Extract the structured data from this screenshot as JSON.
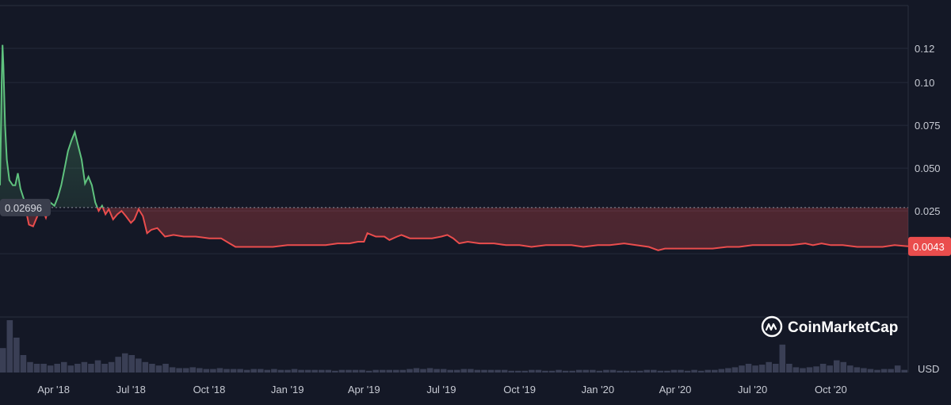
{
  "brand": {
    "name": "CoinMarketCap",
    "icon": "coinmarketcap-logo-icon"
  },
  "currency_label": "USD",
  "colors": {
    "background": "#141826",
    "up": "#5fc27e",
    "down": "#ea4d4d",
    "grid": "#2a2f3f",
    "baseline": "#8a8f9c",
    "volume": "#3a3f55"
  },
  "chart_data": {
    "type": "line",
    "title": "",
    "xlabel": "",
    "ylabel": "",
    "ylim": [
      -0.037,
      0.145
    ],
    "yticks": [
      0.025,
      0.05,
      0.075,
      0.1,
      0.12
    ],
    "ytick_labels": [
      "0.025",
      "0.050",
      "0.075",
      "0.10",
      "0.12"
    ],
    "xticks": [
      "2018-04-01",
      "2018-07-01",
      "2018-10-01",
      "2019-01-01",
      "2019-04-01",
      "2019-07-01",
      "2019-10-01",
      "2020-01-01",
      "2020-04-01",
      "2020-07-01",
      "2020-10-01"
    ],
    "xtick_labels": [
      "Apr '18",
      "Jul '18",
      "Oct '18",
      "Jan '19",
      "Apr '19",
      "Jul '19",
      "Oct '19",
      "Jan '20",
      "Apr '20",
      "Jul '20",
      "Oct '20"
    ],
    "xlim": [
      "2018-01-28",
      "2020-12-31"
    ],
    "baseline": {
      "value": 0.02696,
      "label": "0.02696"
    },
    "last_price": {
      "value": 0.0043,
      "label": "0.0043"
    },
    "grid": true,
    "series": [
      {
        "points": [
          [
            "2018-01-28",
            0.04
          ],
          [
            "2018-01-29",
            0.07
          ],
          [
            "2018-01-30",
            0.1
          ],
          [
            "2018-01-31",
            0.122
          ],
          [
            "2018-02-01",
            0.11
          ],
          [
            "2018-02-03",
            0.075
          ],
          [
            "2018-02-05",
            0.055
          ],
          [
            "2018-02-08",
            0.043
          ],
          [
            "2018-02-12",
            0.04
          ],
          [
            "2018-02-15",
            0.04
          ],
          [
            "2018-02-18",
            0.047
          ],
          [
            "2018-02-21",
            0.038
          ],
          [
            "2018-02-25",
            0.032
          ],
          [
            "2018-02-28",
            0.024
          ],
          [
            "2018-03-03",
            0.017
          ],
          [
            "2018-03-08",
            0.016
          ],
          [
            "2018-03-13",
            0.022
          ],
          [
            "2018-03-18",
            0.027
          ],
          [
            "2018-03-23",
            0.021
          ],
          [
            "2018-03-28",
            0.03
          ],
          [
            "2018-04-02",
            0.028
          ],
          [
            "2018-04-06",
            0.033
          ],
          [
            "2018-04-10",
            0.04
          ],
          [
            "2018-04-14",
            0.05
          ],
          [
            "2018-04-18",
            0.06
          ],
          [
            "2018-04-22",
            0.066
          ],
          [
            "2018-04-26",
            0.071
          ],
          [
            "2018-04-30",
            0.063
          ],
          [
            "2018-05-04",
            0.055
          ],
          [
            "2018-05-08",
            0.041
          ],
          [
            "2018-05-12",
            0.045
          ],
          [
            "2018-05-16",
            0.04
          ],
          [
            "2018-05-20",
            0.03
          ],
          [
            "2018-05-24",
            0.025
          ],
          [
            "2018-05-28",
            0.028
          ],
          [
            "2018-06-01",
            0.023
          ],
          [
            "2018-06-05",
            0.026
          ],
          [
            "2018-06-10",
            0.02
          ],
          [
            "2018-06-15",
            0.023
          ],
          [
            "2018-06-20",
            0.025
          ],
          [
            "2018-06-25",
            0.022
          ],
          [
            "2018-07-01",
            0.018
          ],
          [
            "2018-07-05",
            0.02
          ],
          [
            "2018-07-10",
            0.026
          ],
          [
            "2018-07-15",
            0.022
          ],
          [
            "2018-07-20",
            0.012
          ],
          [
            "2018-07-25",
            0.014
          ],
          [
            "2018-08-01",
            0.015
          ],
          [
            "2018-08-10",
            0.01
          ],
          [
            "2018-08-20",
            0.011
          ],
          [
            "2018-09-01",
            0.01
          ],
          [
            "2018-09-15",
            0.01
          ],
          [
            "2018-10-01",
            0.009
          ],
          [
            "2018-10-15",
            0.009
          ],
          [
            "2018-10-25",
            0.006
          ],
          [
            "2018-11-01",
            0.004
          ],
          [
            "2018-11-15",
            0.004
          ],
          [
            "2018-12-01",
            0.004
          ],
          [
            "2018-12-15",
            0.004
          ],
          [
            "2019-01-01",
            0.005
          ],
          [
            "2019-01-15",
            0.005
          ],
          [
            "2019-02-01",
            0.005
          ],
          [
            "2019-02-15",
            0.005
          ],
          [
            "2019-03-01",
            0.006
          ],
          [
            "2019-03-15",
            0.006
          ],
          [
            "2019-03-25",
            0.007
          ],
          [
            "2019-04-01",
            0.007
          ],
          [
            "2019-04-05",
            0.012
          ],
          [
            "2019-04-15",
            0.01
          ],
          [
            "2019-04-25",
            0.01
          ],
          [
            "2019-05-01",
            0.008
          ],
          [
            "2019-05-10",
            0.01
          ],
          [
            "2019-05-15",
            0.011
          ],
          [
            "2019-05-25",
            0.009
          ],
          [
            "2019-06-05",
            0.009
          ],
          [
            "2019-06-20",
            0.009
          ],
          [
            "2019-07-01",
            0.01
          ],
          [
            "2019-07-08",
            0.011
          ],
          [
            "2019-07-15",
            0.009
          ],
          [
            "2019-07-22",
            0.006
          ],
          [
            "2019-08-01",
            0.007
          ],
          [
            "2019-08-15",
            0.006
          ],
          [
            "2019-09-01",
            0.006
          ],
          [
            "2019-09-15",
            0.005
          ],
          [
            "2019-10-01",
            0.005
          ],
          [
            "2019-10-15",
            0.004
          ],
          [
            "2019-11-01",
            0.005
          ],
          [
            "2019-11-15",
            0.005
          ],
          [
            "2019-12-01",
            0.005
          ],
          [
            "2019-12-15",
            0.004
          ],
          [
            "2020-01-01",
            0.005
          ],
          [
            "2020-01-15",
            0.005
          ],
          [
            "2020-02-01",
            0.006
          ],
          [
            "2020-02-15",
            0.005
          ],
          [
            "2020-03-01",
            0.004
          ],
          [
            "2020-03-12",
            0.002
          ],
          [
            "2020-03-20",
            0.003
          ],
          [
            "2020-04-01",
            0.003
          ],
          [
            "2020-04-15",
            0.003
          ],
          [
            "2020-05-01",
            0.003
          ],
          [
            "2020-05-15",
            0.003
          ],
          [
            "2020-06-01",
            0.004
          ],
          [
            "2020-06-15",
            0.004
          ],
          [
            "2020-07-01",
            0.005
          ],
          [
            "2020-07-15",
            0.005
          ],
          [
            "2020-08-01",
            0.005
          ],
          [
            "2020-08-15",
            0.005
          ],
          [
            "2020-09-01",
            0.006
          ],
          [
            "2020-09-10",
            0.005
          ],
          [
            "2020-09-20",
            0.006
          ],
          [
            "2020-10-01",
            0.005
          ],
          [
            "2020-10-15",
            0.005
          ],
          [
            "2020-11-01",
            0.004
          ],
          [
            "2020-11-15",
            0.004
          ],
          [
            "2020-12-01",
            0.004
          ],
          [
            "2020-12-15",
            0.005
          ],
          [
            "2020-12-31",
            0.0043
          ]
        ]
      }
    ],
    "volume": [
      0.28,
      0.6,
      0.4,
      0.2,
      0.12,
      0.1,
      0.1,
      0.08,
      0.1,
      0.12,
      0.08,
      0.1,
      0.12,
      0.1,
      0.14,
      0.1,
      0.12,
      0.18,
      0.22,
      0.2,
      0.16,
      0.12,
      0.1,
      0.08,
      0.1,
      0.06,
      0.05,
      0.05,
      0.06,
      0.05,
      0.04,
      0.04,
      0.05,
      0.04,
      0.04,
      0.04,
      0.03,
      0.04,
      0.04,
      0.03,
      0.04,
      0.03,
      0.03,
      0.04,
      0.03,
      0.03,
      0.03,
      0.03,
      0.03,
      0.02,
      0.03,
      0.03,
      0.03,
      0.03,
      0.02,
      0.03,
      0.03,
      0.03,
      0.03,
      0.03,
      0.04,
      0.05,
      0.04,
      0.05,
      0.04,
      0.04,
      0.03,
      0.03,
      0.04,
      0.04,
      0.03,
      0.03,
      0.03,
      0.03,
      0.03,
      0.02,
      0.02,
      0.02,
      0.03,
      0.03,
      0.02,
      0.02,
      0.03,
      0.02,
      0.02,
      0.03,
      0.03,
      0.03,
      0.02,
      0.03,
      0.03,
      0.02,
      0.02,
      0.02,
      0.02,
      0.03,
      0.03,
      0.02,
      0.02,
      0.03,
      0.03,
      0.02,
      0.03,
      0.02,
      0.03,
      0.03,
      0.04,
      0.05,
      0.06,
      0.08,
      0.1,
      0.08,
      0.09,
      0.12,
      0.1,
      0.32,
      0.1,
      0.06,
      0.05,
      0.06,
      0.07,
      0.1,
      0.08,
      0.14,
      0.12,
      0.08,
      0.06,
      0.05,
      0.04,
      0.03,
      0.04,
      0.04,
      0.08,
      0.03
    ]
  }
}
